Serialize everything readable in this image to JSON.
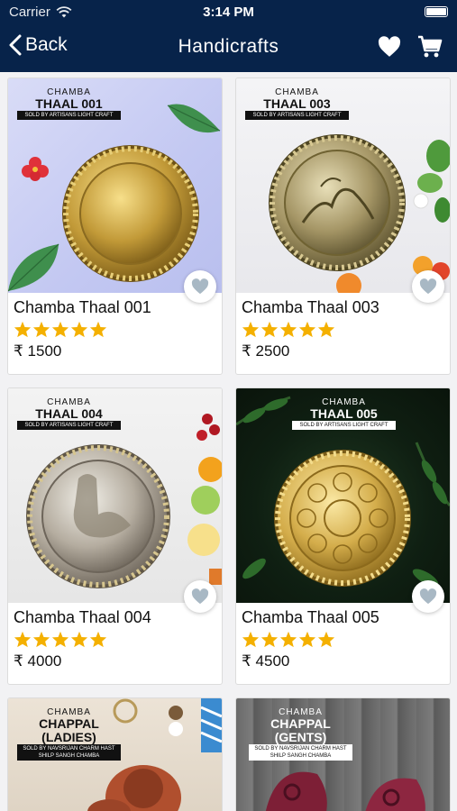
{
  "status_bar": {
    "carrier": "Carrier",
    "time": "3:14 PM"
  },
  "nav": {
    "back_label": "Back",
    "title": "Handicrafts"
  },
  "colors": {
    "nav_background": "#07234a",
    "star": "#f4b000",
    "wishlist_heart": "#a8b8c4"
  },
  "icons": [
    "wifi-icon",
    "battery-icon",
    "chevron-left-icon",
    "heart-icon",
    "cart-icon",
    "star-icon"
  ],
  "products": [
    {
      "name": "Chamba Thaal 001",
      "price": "₹ 1500",
      "rating": 5,
      "banner_brand": "CHAMBA",
      "banner_title": "THAAL 001",
      "banner_seller": "SOLD BY ARTISANS LIGHT CRAFT"
    },
    {
      "name": "Chamba Thaal 003",
      "price": "₹ 2500",
      "rating": 5,
      "banner_brand": "CHAMBA",
      "banner_title": "THAAL 003",
      "banner_seller": "SOLD BY ARTISANS LIGHT CRAFT"
    },
    {
      "name": "Chamba Thaal 004",
      "price": "₹ 4000",
      "rating": 5,
      "banner_brand": "CHAMBA",
      "banner_title": "THAAL 004",
      "banner_seller": "SOLD BY ARTISANS LIGHT CRAFT"
    },
    {
      "name": "Chamba Thaal 005",
      "price": "₹ 4500",
      "rating": 5,
      "banner_brand": "CHAMBA",
      "banner_title": "THAAL 005",
      "banner_seller": "SOLD BY ARTISANS LIGHT CRAFT"
    },
    {
      "banner_brand": "CHAMBA",
      "banner_title": "CHAPPAL (LADIES)",
      "banner_seller": "SOLD BY NAVSRIJAN CHARM HAST SHILP SANGH CHAMBA"
    },
    {
      "banner_brand": "CHAMBA",
      "banner_title": "CHAPPAL (GENTS)",
      "banner_seller": "SOLD BY NAVSRIJAN CHARM HAST SHILP SANGH CHAMBA"
    }
  ]
}
